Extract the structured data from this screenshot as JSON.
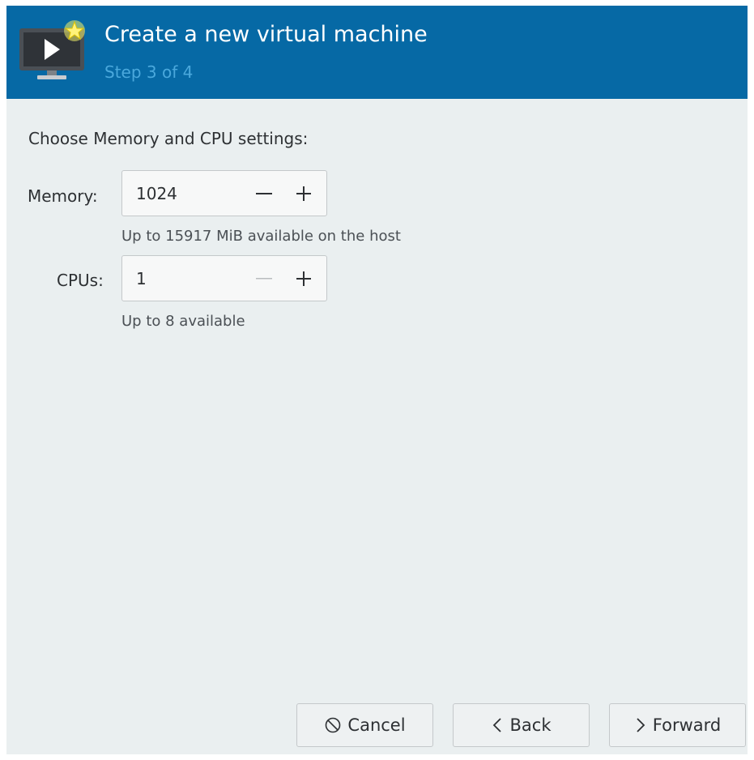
{
  "header": {
    "icon": "new-vm-monitor-icon",
    "title": "Create a new virtual machine",
    "subtitle": "Step 3 of 4",
    "bg_color": "#0669a5",
    "subtitle_color": "#4aa8dc"
  },
  "section": {
    "label": "Choose Memory and CPU settings:"
  },
  "memory": {
    "label": "Memory:",
    "value": "1024",
    "hint": "Up to 15917 MiB available on the host",
    "decrement_enabled": true,
    "increment_enabled": true
  },
  "cpus": {
    "label": "CPUs:",
    "value": "1",
    "hint": "Up to 8 available",
    "decrement_enabled": false,
    "increment_enabled": true
  },
  "buttons": {
    "cancel": {
      "label": "Cancel",
      "icon": "cancel-circle-slash-icon"
    },
    "back": {
      "label": "Back",
      "icon": "chevron-left-icon"
    },
    "forward": {
      "label": "Forward",
      "icon": "chevron-right-icon"
    }
  }
}
